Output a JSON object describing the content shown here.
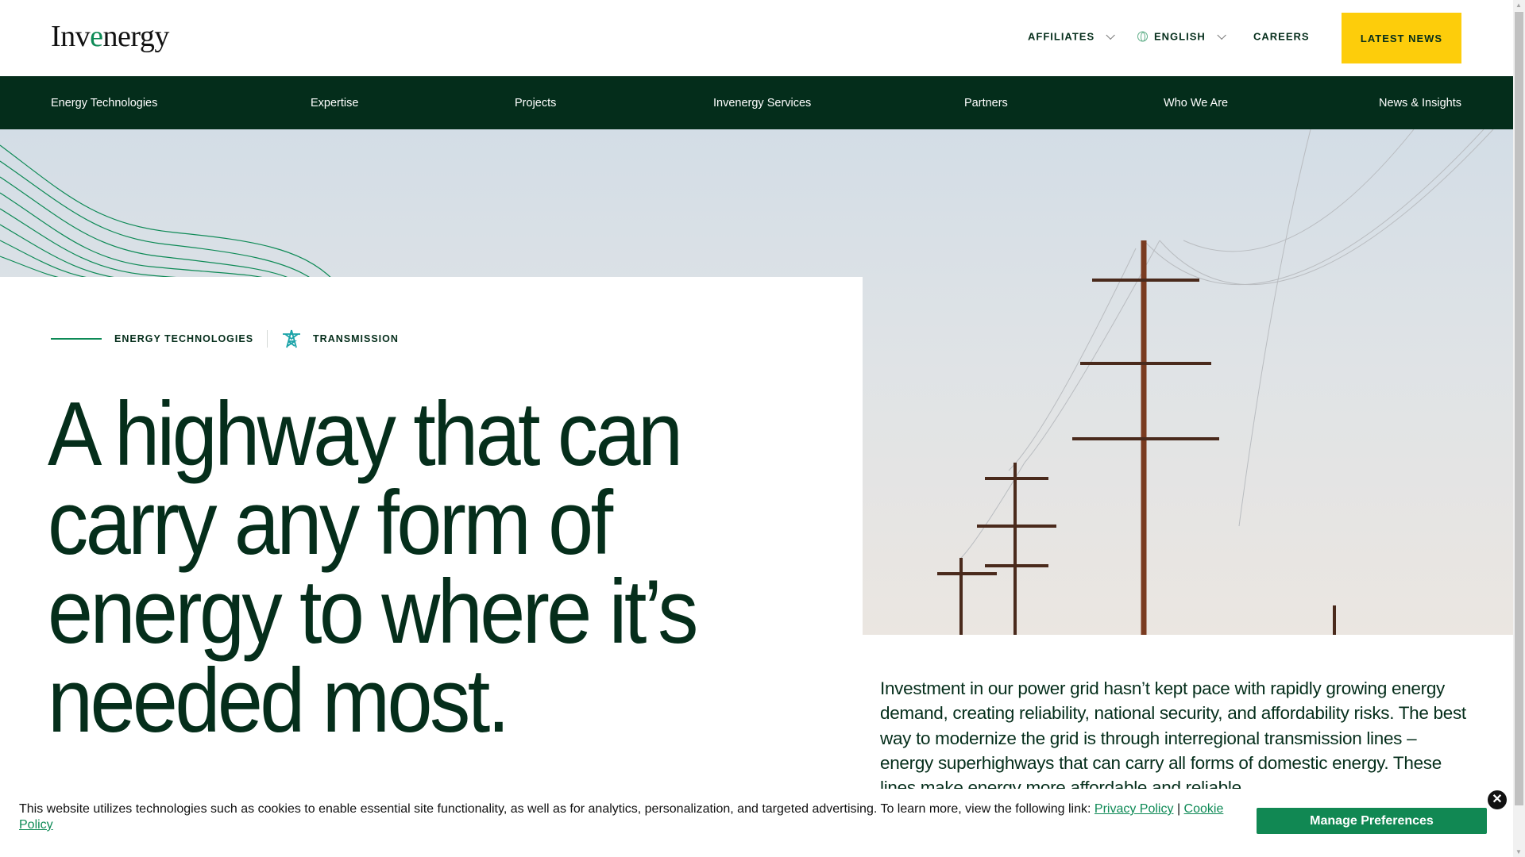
{
  "header": {
    "logo": {
      "pre": "Inv",
      "accent": "e",
      "post": "nergy"
    },
    "affiliates": "AFFILIATES",
    "language": "ENGLISH",
    "careers": "CAREERS",
    "latest_news": "LATEST NEWS"
  },
  "nav": [
    "Energy Technologies",
    "Expertise",
    "Projects",
    "Invenergy Services",
    "Partners",
    "Who We Are",
    "News & Insights"
  ],
  "breadcrumb": {
    "parent": "ENERGY TECHNOLOGIES",
    "current": "TRANSMISSION"
  },
  "headline": "A highway that can carry any form of energy to where it’s needed most.",
  "paragraph": "Investment in our power grid hasn’t kept pace with rapidly growing energy demand, creating reliability, national security, and affordability risks. The best way to modernize the grid is through interregional transmission lines – energy superhighways that can carry all forms of domestic energy. These lines make energy more affordable and reliable.",
  "cookie": {
    "text": "This website utilizes technologies such as cookies to enable essential site functionality, as well as for analytics, personalization, and targeted advertising. To learn more, view the following link:",
    "privacy": "Privacy Policy",
    "sep": "|",
    "cookie_policy": "Cookie Policy",
    "manage": "Manage Preferences",
    "close": "✕"
  },
  "colors": {
    "brand_green": "#042d1b",
    "accent_green": "#0e8a56",
    "yellow": "#fdcd0b",
    "teal_icon": "#1aa3a8"
  }
}
